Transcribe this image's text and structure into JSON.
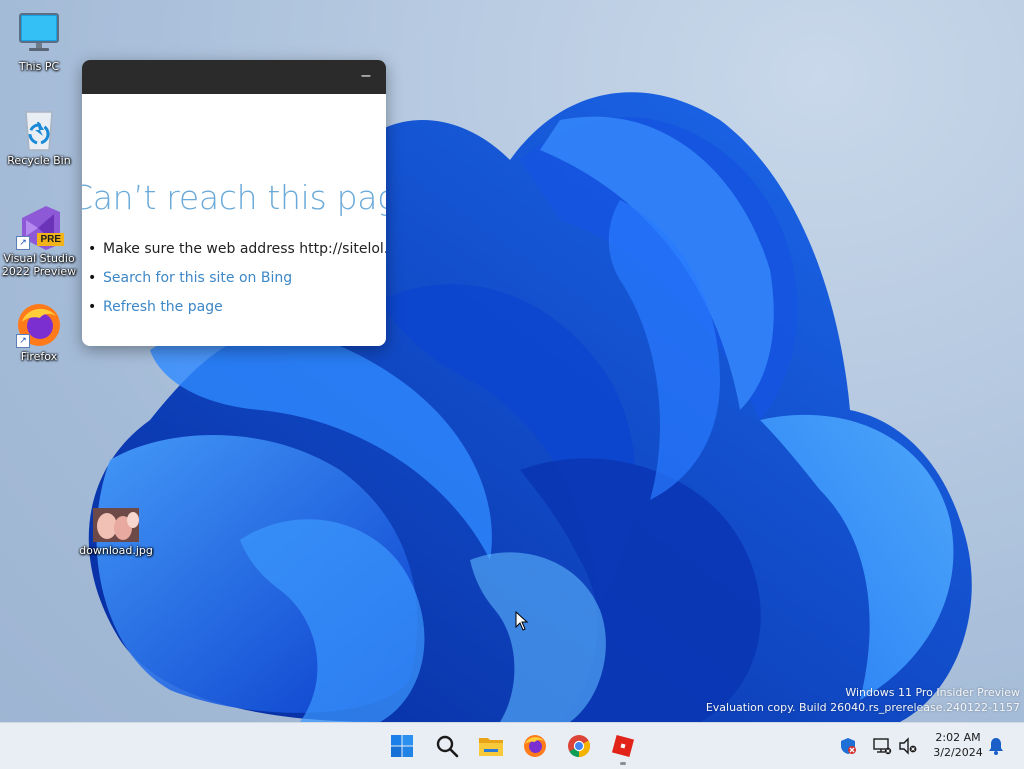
{
  "desktop": {
    "icons": [
      {
        "label": "This PC",
        "icon": "monitor-icon"
      },
      {
        "label": "Recycle Bin",
        "icon": "recycle-bin-icon"
      },
      {
        "label_line1": "Visual Studio",
        "label_line2": "2022 Preview",
        "badge": "PRE",
        "icon": "visual-studio-preview-icon"
      },
      {
        "label": "Firefox",
        "icon": "firefox-icon"
      },
      {
        "label": "download.jpg",
        "icon": "image-file-icon"
      }
    ]
  },
  "browser": {
    "minimize_glyph": "–",
    "error_title": "Can’t reach this page",
    "items": [
      {
        "text": "Make sure the web address http://sitelol.m",
        "type": "plain"
      },
      {
        "text": "Search for this site on Bing",
        "type": "link"
      },
      {
        "text": "Refresh the page",
        "type": "link"
      }
    ]
  },
  "watermark": {
    "line1": "Windows 11 Pro Insider Preview",
    "line2": "Evaluation copy. Build 26040.rs_prerelease.240122-1157"
  },
  "taskbar": {
    "apps": [
      "start-icon",
      "search-icon",
      "file-explorer-icon",
      "firefox-icon",
      "chrome-icon",
      "roblox-icon"
    ],
    "time": "2:02 AM",
    "date": "3/2/2024",
    "tray_icons": [
      "windows-security-icon",
      "network-icon",
      "volume-muted-icon",
      "notification-bell-icon"
    ]
  },
  "colors": {
    "accent": "#1f6fe8",
    "link": "#3c87c7",
    "error_title": "#6aa9d8",
    "taskbar": "#e9eef5"
  }
}
